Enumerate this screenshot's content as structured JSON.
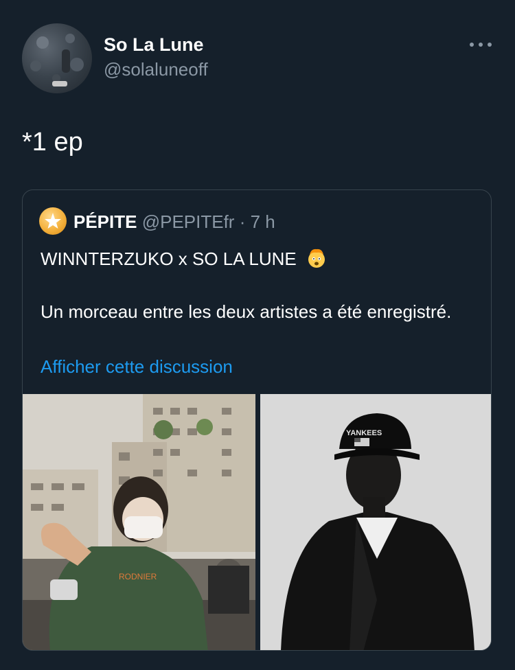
{
  "tweet": {
    "author": {
      "display_name": "So La Lune",
      "handle": "@solaluneoff"
    },
    "text": "*1 ep",
    "more_icon": "more-horizontal-icon"
  },
  "quote": {
    "author_name": "PÉPITE",
    "meta": "@PEPITEfr · 7 h",
    "text_line1": "WINNTERZUKO x SO LA LUNE",
    "emoji": "exploding-head-emoji",
    "text_body": "Un morceau entre les deux artistes a été enregistré.",
    "link": "Afficher cette discussion",
    "avatar_icon": "star-icon"
  },
  "colors": {
    "background": "#15202b",
    "secondary_text": "#8b98a5",
    "link": "#1d9bf0",
    "border": "#38444d"
  }
}
